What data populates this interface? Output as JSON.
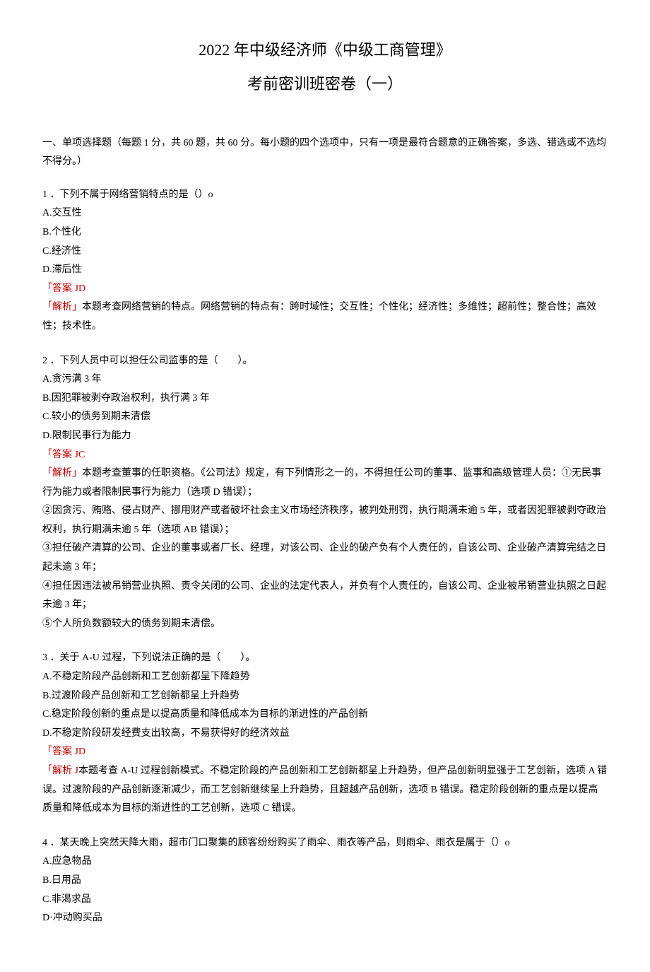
{
  "header": {
    "title": "2022 年中级经济师《中级工商管理》",
    "subtitle": "考前密训班密卷（一）"
  },
  "section": {
    "heading": "一、单项选择题（每题 1 分，共 60 题，共 60 分。每小题的四个选项中，只有一项是最符合题意的正确答案，多选、错选或不选均不得分。）"
  },
  "questions": [
    {
      "stem": "1 ．下列不属于网络营销特点的是（）o",
      "options": {
        "A": "A.交互性",
        "B": "B.个性化",
        "C": "C.经济性",
        "D": "D.滞后性"
      },
      "answer_label": "「答案 JD",
      "explain_label": "「解析」",
      "explain_text": "本题考查网络营销的特点。网络营销的特点有：跨时域性；交互性；个性化；经济性；多维性；超前性；整合性；高效性；技术性。"
    },
    {
      "stem": "2 ．下列人员中可以担任公司监事的是（　　）。",
      "options": {
        "A": "A.贪污满 3 年",
        "B": "B.因犯罪被剥夺政治权利，执行满 3 年",
        "C": "C.较小的债务到期未清偿",
        "D": "D.限制民事行为能力"
      },
      "answer_label": "「答案 JC",
      "explain_label": "「解析」",
      "explain_paras": [
        "本题考查董事的任职资格。《公司法》规定，有下列情形之一的，不得担任公司的董事、监事和高级管理人员：①无民事行为能力或者限制民事行为能力（选项 D 错误）；",
        "②因贪污、贿赂、侵占财产、挪用财产或者破坏社会主义市场经济秩序，被判处刑罚，执行期满未逾 5 年，或者因犯罪被剥夺政治权利，执行期满未逾 5 年（选项 AB 错误）；",
        "③担任破产清算的公司、企业的董事或者厂长、经理，对该公司、企业的破产负有个人责任的，自该公司、企业破产清算完结之日起未逾 3 年；",
        "④担任因违法被吊销营业执照、责令关闭的公司、企业的法定代表人，并负有个人责任的，自该公司、企业被吊销营业执照之日起未逾 3 年；",
        "⑤个人所负数额较大的债务到期未清偿。"
      ]
    },
    {
      "stem": "3 ．关于 A-U 过程，下列说法正确的是（　　）。",
      "options": {
        "A": "A.不稳定阶段产品创新和工艺创新都呈下降趋势",
        "B": "B.过渡阶段产品创新和工艺创新都呈上升趋势",
        "C": "C.稳定阶段创新的重点是以提高质量和降低成本为目标的渐进性的产品创新",
        "D": "D.不稳定阶段研发经费支出较高，不易获得好的经济效益"
      },
      "answer_label": "「答案 JD",
      "explain_label": "「解析 J",
      "explain_text": "本题考查 A-U 过程创新模式。不稳定阶段的产品创新和工艺创新都呈上升趋势，但产品创新明显强于工艺创新，选项 A 错误。过渡阶段的产品创新逐渐减少，而工艺创新继续呈上升趋势，且超越产品创新，选项 B 错误。稳定阶段创新的重点是以提高质量和降低成本为目标的渐进性的工艺创新，选项 C 错误。"
    },
    {
      "stem": "4 ．某天晚上突然天降大雨，超市门口聚集的顾客纷纷购买了雨伞、雨衣等产品，则雨伞、雨衣是属于（）o",
      "options": {
        "A": "A.应急物品",
        "B": "B.日用品",
        "C": "C.非渴求品",
        "D": "D·冲动购买品"
      }
    }
  ]
}
